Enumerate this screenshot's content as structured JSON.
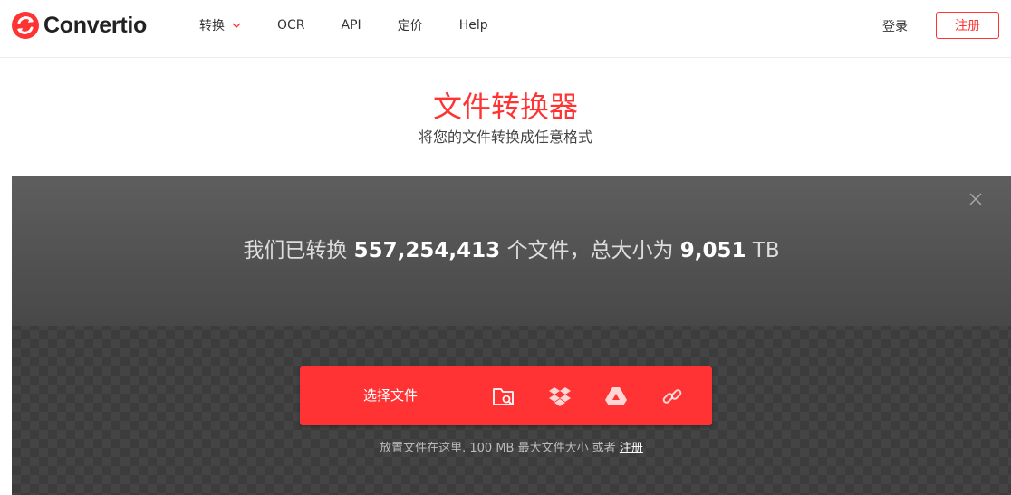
{
  "header": {
    "logo_text": "Convertio",
    "nav": [
      "转换",
      "OCR",
      "API",
      "定价",
      "Help"
    ],
    "login": "登录",
    "signup": "注册"
  },
  "hero": {
    "title": "文件转换器",
    "subtitle": "将您的文件转换成任意格式"
  },
  "stats": {
    "prefix": "我们已转换",
    "files_count": "557,254,413",
    "middle": "个文件，总大小为",
    "total_size": "9,051",
    "unit": "TB"
  },
  "upload": {
    "button_label": "选择文件",
    "sources": [
      "folder-search-icon",
      "dropbox-icon",
      "google-drive-icon",
      "url-link-icon"
    ]
  },
  "hint": {
    "text": "放置文件在这里. 100 MB 最大文件大小 或者",
    "link": "注册"
  },
  "colors": {
    "brand": "#ff3333",
    "panel": "#3c3c3c"
  }
}
